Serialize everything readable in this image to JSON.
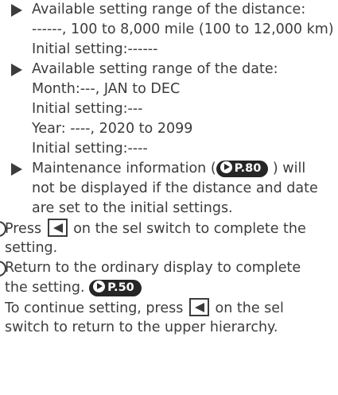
{
  "notes": [
    {
      "lines": [
        "Available setting range of the distance:",
        "------, 100 to 8,000 mile (100 to 12,000 km)",
        "Initial setting:------"
      ]
    },
    {
      "lines": [
        "Available setting range of the date:",
        "Month:---, JAN to DEC",
        "Initial setting:---",
        "Year: ----, 2020 to 2099",
        "Initial setting:----"
      ]
    },
    {
      "line1_before": "Maintenance information (",
      "ref": "P.80",
      "line1_after": ") will",
      "lines": [
        "not be displayed if the distance and date",
        "are set to the initial settings."
      ]
    }
  ],
  "steps": [
    {
      "line1_before": "Press",
      "line1_after": "on the sel switch to complete the",
      "line2": "setting."
    },
    {
      "line1": "Return to the ordinary display to complete",
      "line2_before": "the setting.",
      "ref": "P.50",
      "line3": "To continue setting, press",
      "line3_after": "on the sel",
      "line4": "switch to return to the upper hierarchy."
    }
  ]
}
